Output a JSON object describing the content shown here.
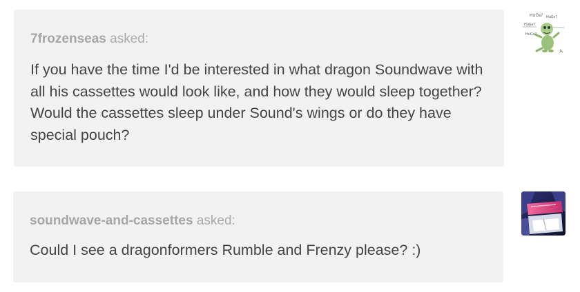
{
  "asks": [
    {
      "asker": "7frozenseas",
      "asked_label": "asked:",
      "question": "If you have the time I'd be interested in what dragon Soundwave with all his cassettes would look like, and how they would sleep together? Would the cassettes sleep under Sound's wings or do they have special pouch?",
      "avatar_icon": "green-dinosaur-hugs-avatar",
      "avatar_text": [
        "HuGs?",
        "HuGs?",
        "HuGs?",
        "HuGs?"
      ]
    },
    {
      "asker": "soundwave-and-cassettes",
      "asked_label": "asked:",
      "question": "Could I see a dragonformers Rumble and Frenzy please? :)",
      "avatar_icon": "soundwave-visor-avatar"
    }
  ],
  "colors": {
    "box_background": "#f2f2f2",
    "asker_text": "#a6a6a6",
    "question_text": "#444444",
    "avatar2_background": "#1c2050",
    "avatar2_visor": "#e0457b"
  }
}
